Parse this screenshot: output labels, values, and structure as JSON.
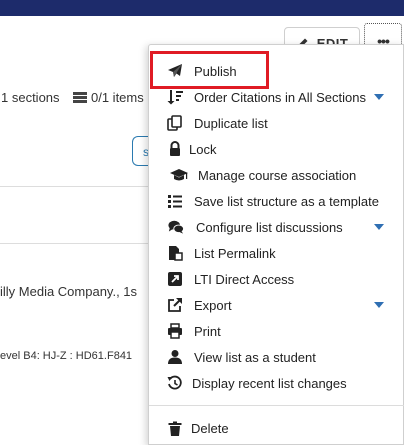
{
  "toolbar": {
    "edit_label": "EDIT",
    "more_label": "•••"
  },
  "meta": {
    "sections_text": "1 sections",
    "items_text": "0/1 items"
  },
  "background": {
    "pill_text": "s",
    "text_line_1": "illy Media Company., 1s",
    "text_line_2": "evel B4: HJ-Z : HD61.F841"
  },
  "menu": {
    "items": [
      {
        "label": "Publish",
        "icon": "paper-plane-icon",
        "has_caret": false
      },
      {
        "label": "Order Citations in All Sections",
        "icon": "sort-icon",
        "has_caret": true
      },
      {
        "label": "Duplicate list",
        "icon": "copy-icon",
        "has_caret": false
      },
      {
        "label": "Lock",
        "icon": "lock-icon",
        "has_caret": false
      },
      {
        "label": "Manage course association",
        "icon": "graduation-cap-icon",
        "has_caret": false
      },
      {
        "label": "Save list structure as a template",
        "icon": "list-icon",
        "has_caret": false
      },
      {
        "label": "Configure list discussions",
        "icon": "comments-icon",
        "has_caret": true
      },
      {
        "label": "List Permalink",
        "icon": "document-link-icon",
        "has_caret": false
      },
      {
        "label": "LTI Direct Access",
        "icon": "external-square-icon",
        "has_caret": false
      },
      {
        "label": "Export",
        "icon": "share-icon",
        "has_caret": true
      },
      {
        "label": "Print",
        "icon": "print-icon",
        "has_caret": false
      },
      {
        "label": "View list as a student",
        "icon": "user-icon",
        "has_caret": false
      },
      {
        "label": "Display recent list changes",
        "icon": "history-icon",
        "has_caret": false
      },
      {
        "label": "Delete",
        "icon": "trash-icon",
        "has_caret": false
      }
    ]
  },
  "colors": {
    "topbar": "#1d2b6b",
    "accent": "#2f6fb3",
    "highlight": "#e01b24"
  }
}
